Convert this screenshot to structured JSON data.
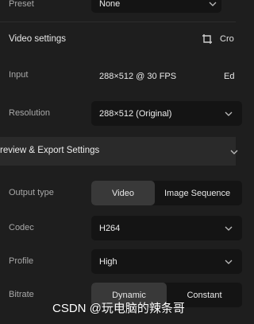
{
  "preset": {
    "label": "Preset",
    "value": "None"
  },
  "video_settings": {
    "title": "Video settings",
    "crop_label": "Cro"
  },
  "input": {
    "label": "Input",
    "value": "288×512 @ 30 FPS",
    "edit_label": "Ed"
  },
  "resolution": {
    "label": "Resolution",
    "value": "288×512 (Original)"
  },
  "export_section": {
    "title": "review & Export Settings"
  },
  "output_type": {
    "label": "Output type",
    "options": [
      "Video",
      "Image Sequence"
    ],
    "selected": "Video"
  },
  "codec": {
    "label": "Codec",
    "value": "H264"
  },
  "profile": {
    "label": "Profile",
    "value": "High"
  },
  "bitrate": {
    "label": "Bitrate",
    "options": [
      "Dynamic",
      "Constant"
    ],
    "selected": "Dynamic"
  },
  "watermark": {
    "text": "CSDN @玩电脑的辣条哥"
  },
  "colors": {
    "background": "#1e1e1e",
    "field": "#141414",
    "section_header": "#2a2a2a",
    "active_segment": "#393939"
  }
}
